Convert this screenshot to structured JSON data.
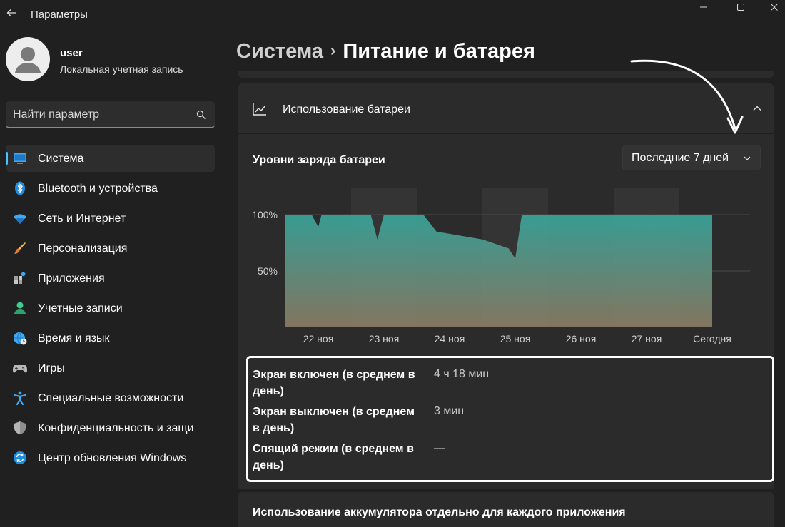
{
  "window": {
    "title": "Параметры"
  },
  "profile": {
    "name": "user",
    "account_type": "Локальная учетная запись"
  },
  "search": {
    "placeholder": "Найти параметр"
  },
  "nav": {
    "items": [
      {
        "label": "Система",
        "icon": "system-icon",
        "active": true
      },
      {
        "label": "Bluetooth и устройства",
        "icon": "bluetooth-icon"
      },
      {
        "label": "Сеть и Интернет",
        "icon": "wifi-icon"
      },
      {
        "label": "Персонализация",
        "icon": "brush-icon"
      },
      {
        "label": "Приложения",
        "icon": "apps-icon"
      },
      {
        "label": "Учетные записи",
        "icon": "person-icon"
      },
      {
        "label": "Время и язык",
        "icon": "globe-clock-icon"
      },
      {
        "label": "Игры",
        "icon": "gamepad-icon"
      },
      {
        "label": "Специальные возможности",
        "icon": "accessibility-icon"
      },
      {
        "label": "Конфиденциальность и защи",
        "icon": "shield-icon"
      },
      {
        "label": "Центр обновления Windows",
        "icon": "update-icon"
      }
    ]
  },
  "breadcrumb": {
    "parent": "Система",
    "separator": "›",
    "current": "Питание и батарея"
  },
  "battery_card": {
    "title": "Использование батареи",
    "levels_title": "Уровни заряда батареи",
    "period": "Последние 7 дней"
  },
  "chart_data": {
    "type": "area",
    "categories": [
      "22 ноя",
      "23 ноя",
      "24 ноя",
      "25 ноя",
      "26 ноя",
      "27 ноя",
      "Сегодня"
    ],
    "y_tick_labels": [
      "100%",
      "50%"
    ],
    "y_ticks": [
      100,
      50
    ],
    "ylim": [
      0,
      100
    ],
    "x": [
      0,
      0.05,
      0.4,
      0.5,
      0.55,
      0.6,
      1.0,
      1.3,
      1.4,
      1.5,
      1.6,
      2.1,
      2.3,
      3.0,
      3.4,
      3.5,
      3.6,
      4.0,
      5.0,
      6.0,
      6.5
    ],
    "values": [
      100,
      100,
      100,
      89,
      100,
      100,
      100,
      100,
      78,
      100,
      100,
      100,
      85,
      78,
      70,
      61,
      100,
      100,
      100,
      100,
      100
    ],
    "shaded_days": [
      1,
      3,
      5
    ],
    "colors": {
      "fill_top": "#39a59b",
      "fill_bottom": "#8a7b64"
    }
  },
  "stats": [
    {
      "label": "Экран включен (в среднем в день)",
      "value": "4 ч 18 мин"
    },
    {
      "label": "Экран выключен (в среднем в день)",
      "value": "3 мин"
    },
    {
      "label": "Спящий режим (в среднем в день)",
      "value": "—"
    }
  ],
  "app_usage": {
    "title": "Использование аккумулятора отдельно для каждого приложения"
  }
}
